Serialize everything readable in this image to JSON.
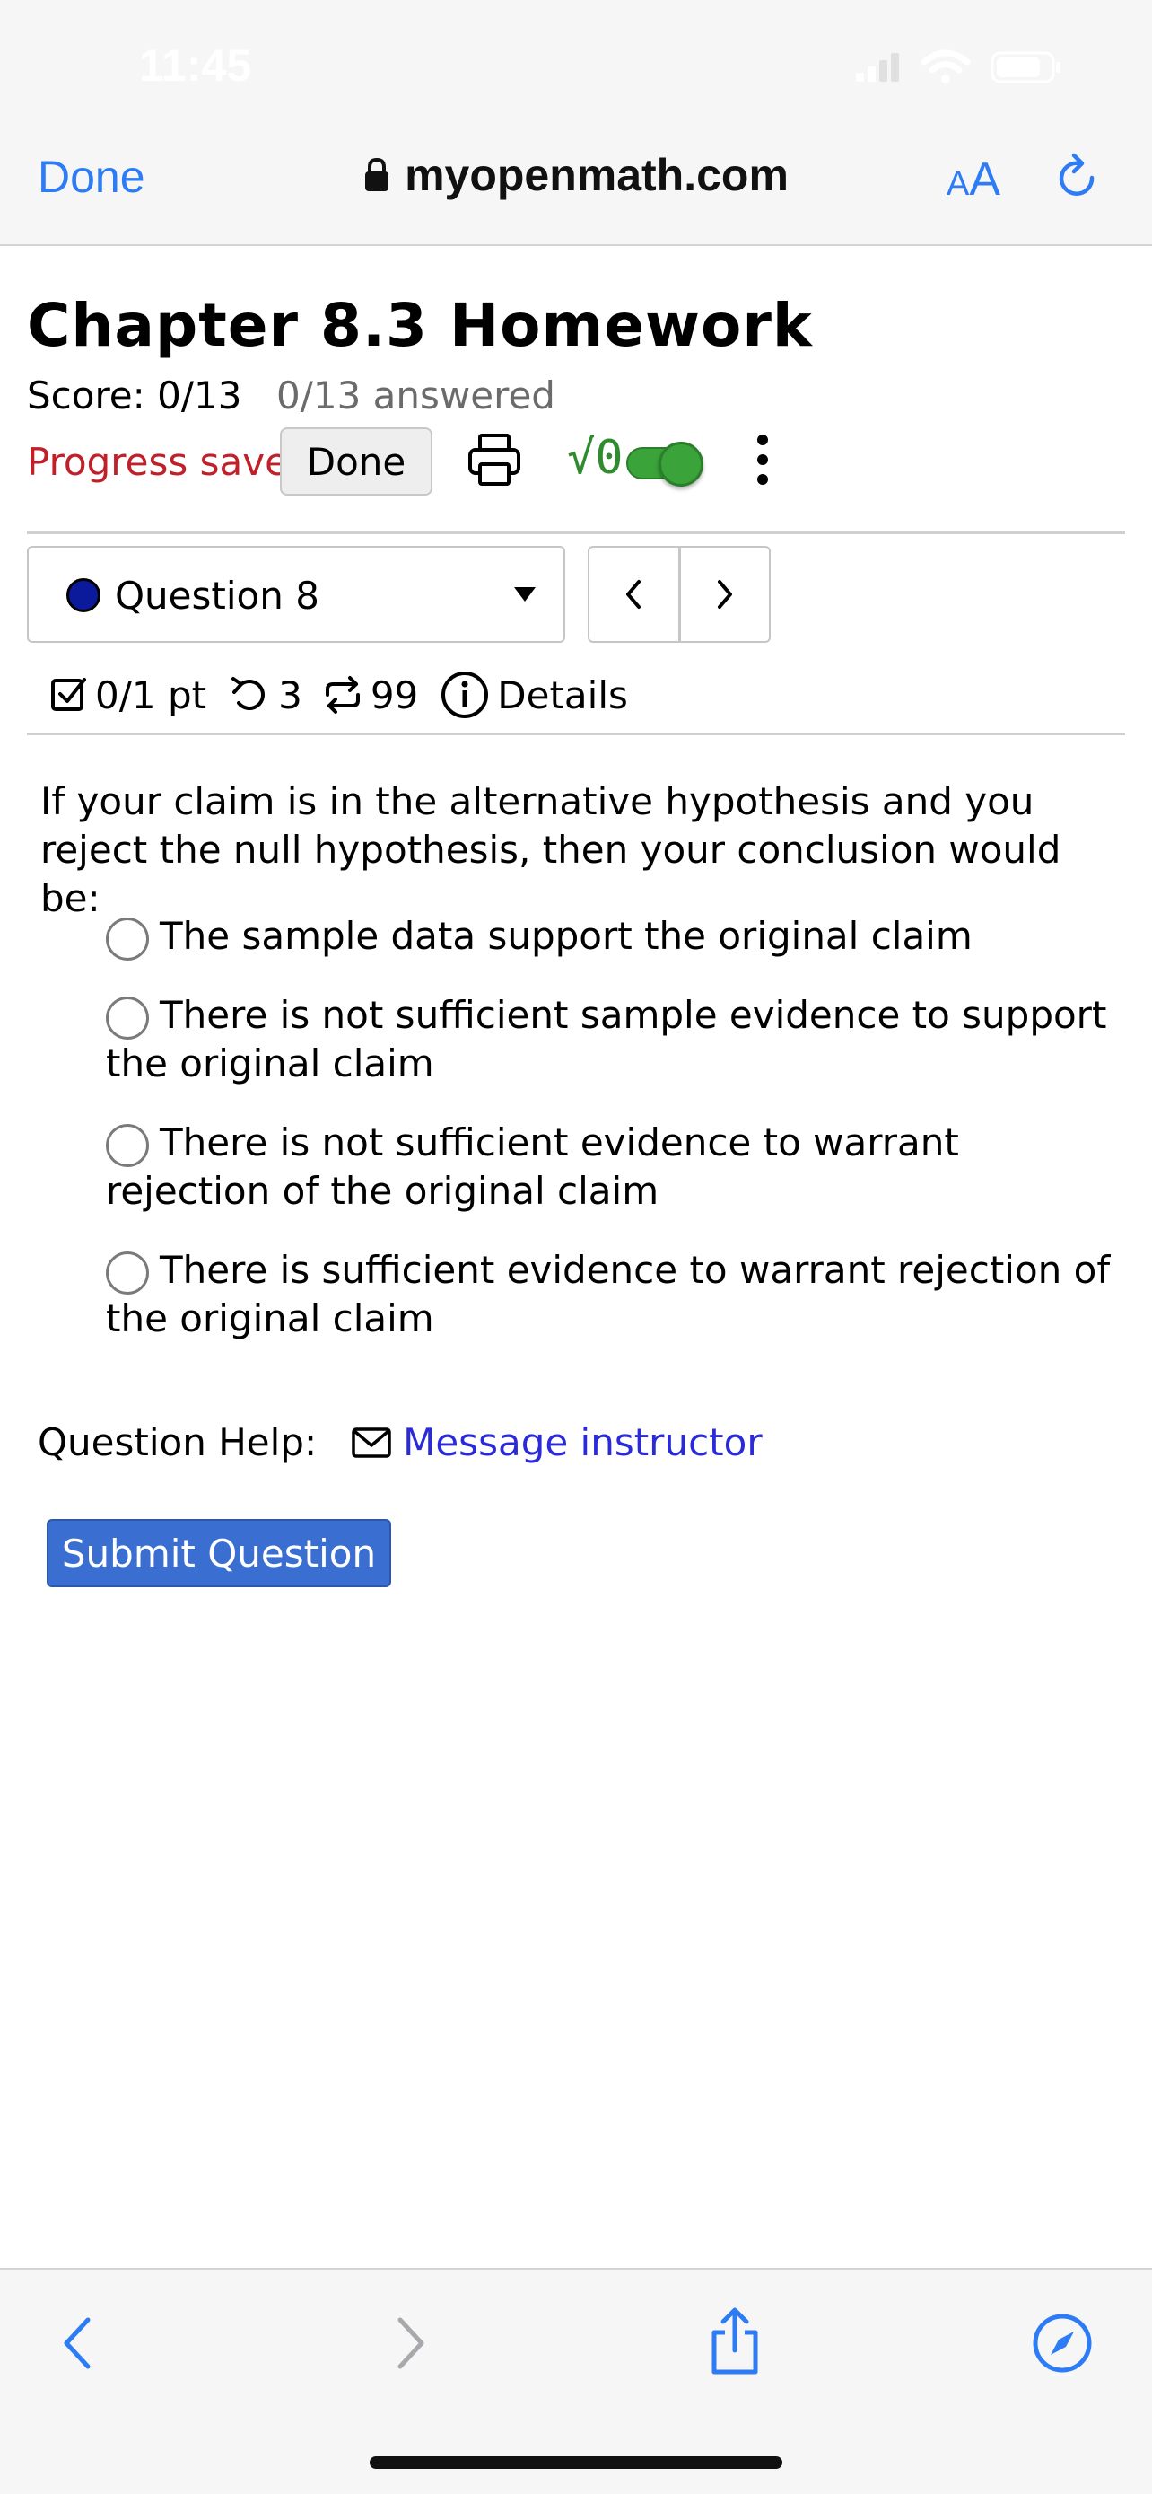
{
  "status_bar": {
    "time": "11:45"
  },
  "browser": {
    "done_label": "Done",
    "url": "myopenmath.com",
    "aa_small": "A",
    "aa_big": "A"
  },
  "page": {
    "title": "Chapter 8.3 Homework",
    "score": "Score: 0/13",
    "answered": "0/13 answered",
    "progress_saved": "Progress saved",
    "done_label": "Done",
    "math_toggle_label": "√0",
    "question_selector": "Question 8",
    "meta": {
      "points": "0/1 pt",
      "attempts": "3",
      "regens": "99",
      "details": "Details"
    },
    "question_text": "If your claim is in the alternative hypothesis and you reject the null hypothesis, then your conclusion would be:",
    "options": [
      "The sample data support the original claim",
      "There is not sufficient sample evidence to support the original claim",
      "There is not sufficient evidence to warrant rejection of the original claim",
      "There is sufficient evidence to warrant rejection of the original claim"
    ],
    "help_label": "Question Help:",
    "message_link": "Message instructor",
    "submit_label": "Submit Question"
  },
  "colors": {
    "accent": "#2d7cf6",
    "progress_saved": "#c0202a",
    "submit": "#3a6fd1",
    "toggle": "#3aa33a",
    "link": "#2a2ad8"
  }
}
